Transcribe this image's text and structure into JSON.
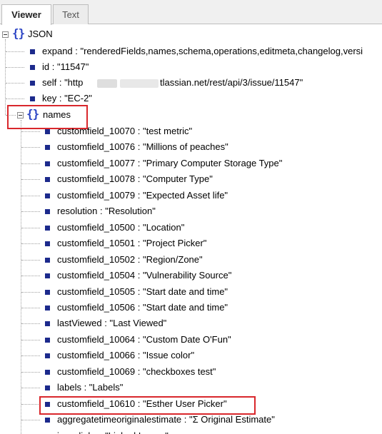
{
  "tabs": {
    "viewer": "Viewer",
    "text": "Text"
  },
  "root": {
    "label": "JSON"
  },
  "top_fields": [
    {
      "text": "expand : \"renderedFields,names,schema,operations,editmeta,changelog,versi"
    },
    {
      "text": "id : \"11547\""
    },
    {
      "self_start": "self : \"http",
      "self_end": "tlassian.net/rest/api/3/issue/11547\""
    },
    {
      "text": "key : \"EC-2\""
    }
  ],
  "names": {
    "label": "names",
    "items": [
      "customfield_10070 : \"test metric\"",
      "customfield_10076 : \"Millions of peaches\"",
      "customfield_10077 : \"Primary Computer Storage Type\"",
      "customfield_10078 : \"Computer Type\"",
      "customfield_10079 : \"Expected Asset life\"",
      "resolution : \"Resolution\"",
      "customfield_10500 : \"Location\"",
      "customfield_10501 : \"Project Picker\"",
      "customfield_10502 : \"Region/Zone\"",
      "customfield_10504 : \"Vulnerability Source\"",
      "customfield_10505 : \"Start date and time\"",
      "customfield_10506 : \"Start date and time\"",
      "lastViewed : \"Last Viewed\"",
      "customfield_10064 : \"Custom Date O'Fun\"",
      "customfield_10066 : \"Issue color\"",
      "customfield_10069 : \"checkboxes test\"",
      "labels : \"Labels\"",
      "customfield_10610 : \"Esther User Picker\"",
      "aggregatetimeoriginalestimate : \"Σ Original Estimate\"",
      "issuelinks : \"Linked Issues\""
    ]
  }
}
